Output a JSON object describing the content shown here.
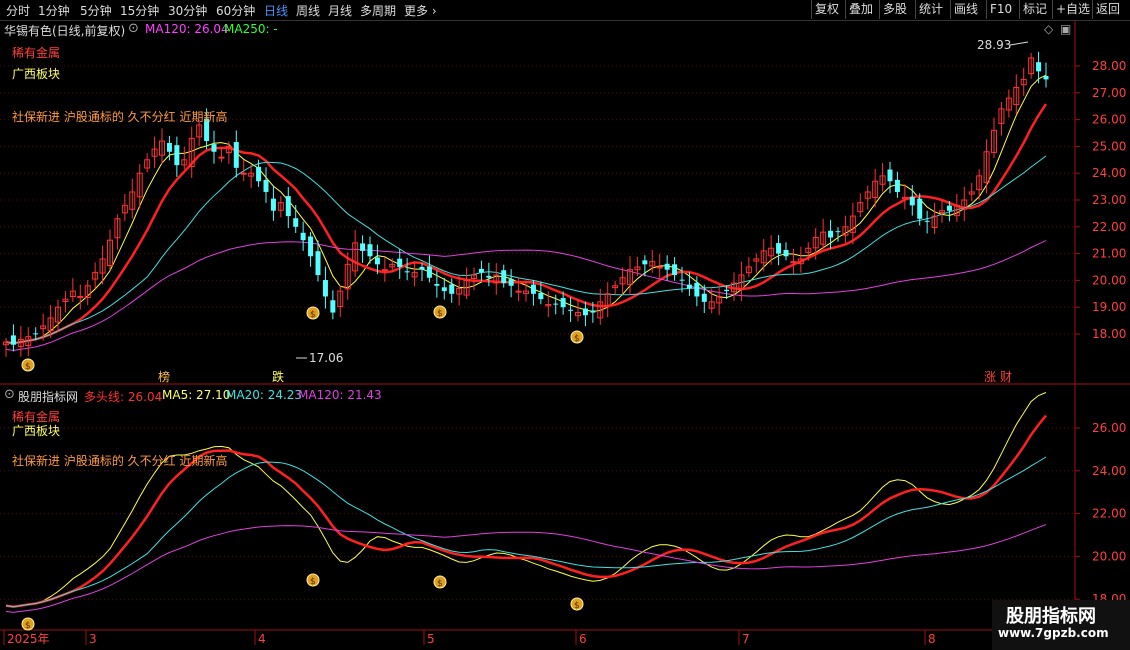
{
  "toolbar": {
    "tabs": [
      "分时",
      "1分钟",
      "5分钟",
      "15分钟",
      "30分钟",
      "60分钟",
      "日线",
      "周线",
      "月线",
      "多周期",
      "更多"
    ],
    "active_tab": "日线",
    "right": [
      "复权",
      "叠加",
      "多股",
      "统计",
      "画线",
      "F10",
      "标记",
      "+自选",
      "返回"
    ]
  },
  "stock": {
    "name": "华锡有色(日线,前复权)",
    "ma120": "MA120: 26.04",
    "ma250": "MA250: -"
  },
  "tags": [
    "稀有金属",
    "广西板块",
    "社保新进 沪股通标的 久不分红 近期新高"
  ],
  "price_axis": [
    "28.00",
    "27.00",
    "26.00",
    "25.00",
    "24.00",
    "23.00",
    "22.00",
    "21.00",
    "20.00",
    "19.00",
    "18.00"
  ],
  "price_high_label": "28.93",
  "price_low_label": "17.06",
  "event_markers": [
    "榜",
    "跌",
    "涨",
    "财"
  ],
  "indicator": {
    "name": "股朋指标网",
    "multi": "多头线: 26.04",
    "ma5": "MA5: 27.10",
    "ma20": "MA20: 24.23",
    "ma120": "MA120: 21.43"
  },
  "ind_axis": [
    "26.00",
    "24.00",
    "22.00",
    "20.00",
    "18.00"
  ],
  "date_axis": [
    "2025年",
    "3",
    "4",
    "5",
    "6",
    "7",
    "8"
  ],
  "watermark": {
    "line1": "股朋指标网",
    "line2": "www.7gpzb.com"
  },
  "colors": {
    "up": "#ff3232",
    "down": "#54ffff",
    "ma5": "#ffff40",
    "ma20": "#40e0e0",
    "ma120": "#e040e0",
    "thick": "#ff2020",
    "thick_alt": "#30e030"
  }
}
